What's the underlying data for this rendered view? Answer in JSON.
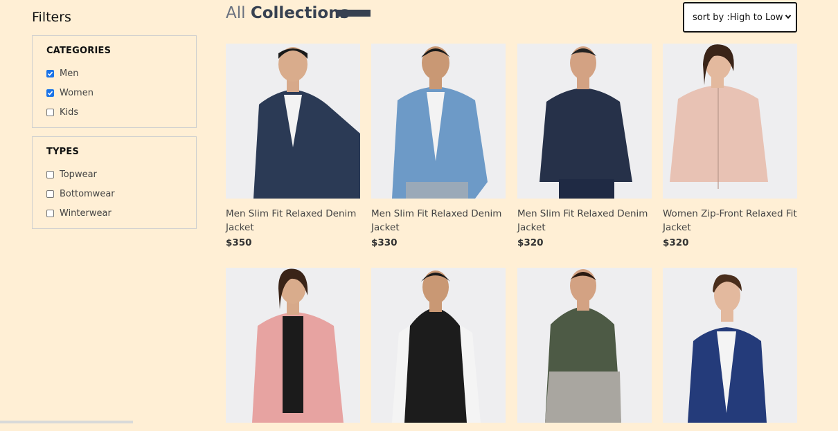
{
  "sidebar": {
    "title": "Filters",
    "categories": {
      "heading": "CATEGORIES",
      "options": [
        {
          "label": "Men",
          "checked": true
        },
        {
          "label": "Women",
          "checked": true
        },
        {
          "label": "Kids",
          "checked": false
        }
      ]
    },
    "types": {
      "heading": "TYPES",
      "options": [
        {
          "label": "Topwear",
          "checked": false
        },
        {
          "label": "Bottomwear",
          "checked": false
        },
        {
          "label": "Winterwear",
          "checked": false
        }
      ]
    }
  },
  "header": {
    "title_prefix": "All",
    "title_main": "Collections",
    "sort": {
      "selected": "sort by :High to Low"
    }
  },
  "products": [
    {
      "name": "Men Slim Fit Relaxed Denim Jacket",
      "price": "$350"
    },
    {
      "name": "Men Slim Fit Relaxed Denim Jacket",
      "price": "$330"
    },
    {
      "name": "Men Slim Fit Relaxed Denim Jacket",
      "price": "$320"
    },
    {
      "name": "Women Zip-Front Relaxed Fit Jacket",
      "price": "$320"
    },
    {
      "name": "",
      "price": ""
    },
    {
      "name": "",
      "price": ""
    },
    {
      "name": "",
      "price": ""
    },
    {
      "name": "",
      "price": ""
    }
  ],
  "colors": {
    "background": "#ffefd5",
    "accent": "#374151",
    "checkbox": "#1a73e8"
  }
}
